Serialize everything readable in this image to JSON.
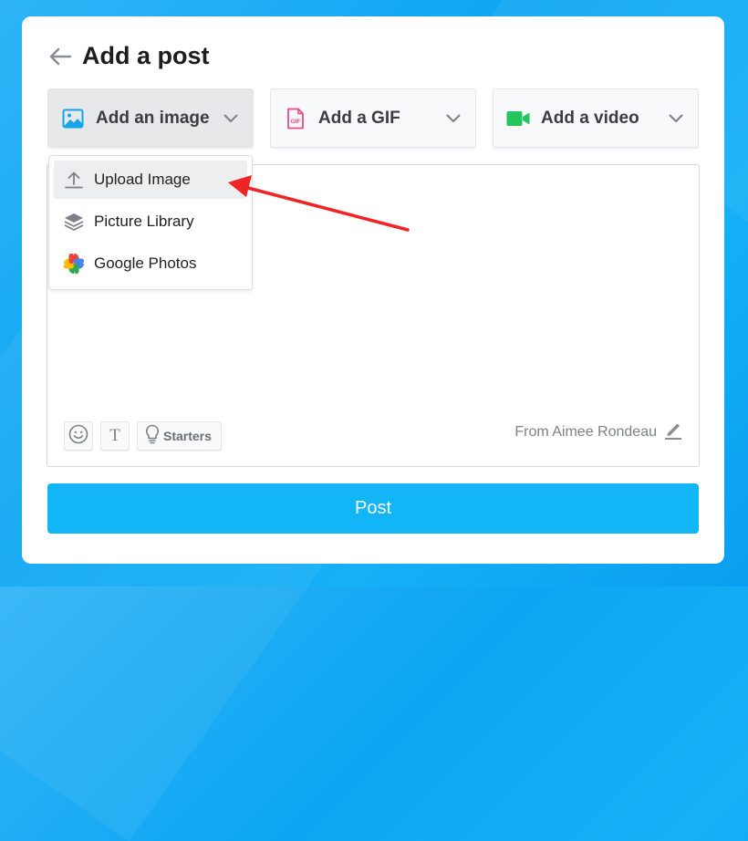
{
  "page": {
    "title": "Add a post"
  },
  "tabs": [
    {
      "label": "Add an image",
      "icon": "image-icon"
    },
    {
      "label": "Add a GIF",
      "icon": "gif-icon"
    },
    {
      "label": "Add a video",
      "icon": "video-camera-icon"
    }
  ],
  "dropdown": {
    "items": [
      {
        "label": "Upload Image",
        "icon": "upload-icon"
      },
      {
        "label": "Picture Library",
        "icon": "layers-icon"
      },
      {
        "label": "Google Photos",
        "icon": "google-photos-icon"
      }
    ]
  },
  "editor": {
    "starters_label": "Starters",
    "from_text": "From Aimee Rondeau",
    "text_button_glyph": "T"
  },
  "post_button": {
    "label": "Post"
  },
  "colors": {
    "accent": "#12b5f5",
    "annotation_arrow": "#f02424",
    "gif_pink": "#f0468c",
    "video_green": "#22c55e",
    "image_blue": "#12a6e8"
  }
}
